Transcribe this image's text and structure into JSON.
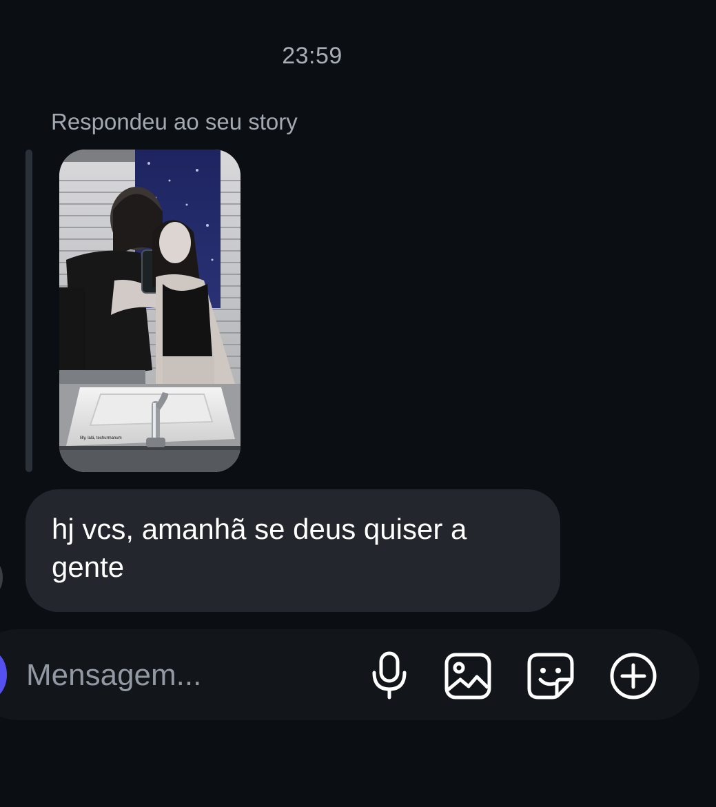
{
  "thread": {
    "timestamp": "23:59",
    "reply_context": "Respondeu ao seu story",
    "story_caption": "lilly, lalá, techurmanum",
    "message_text": "hj vcs, amanhã se deus quiser a gente"
  },
  "composer": {
    "placeholder": "Mensagem...",
    "icons": [
      "microphone-icon",
      "image-icon",
      "sticker-icon",
      "plus-circle-icon"
    ]
  },
  "colors": {
    "background": "#0b0f14",
    "bubble": "#23272d",
    "composer": "#12151a",
    "avatar_accent": "#5551f0",
    "muted_text": "#a3a9b1"
  }
}
